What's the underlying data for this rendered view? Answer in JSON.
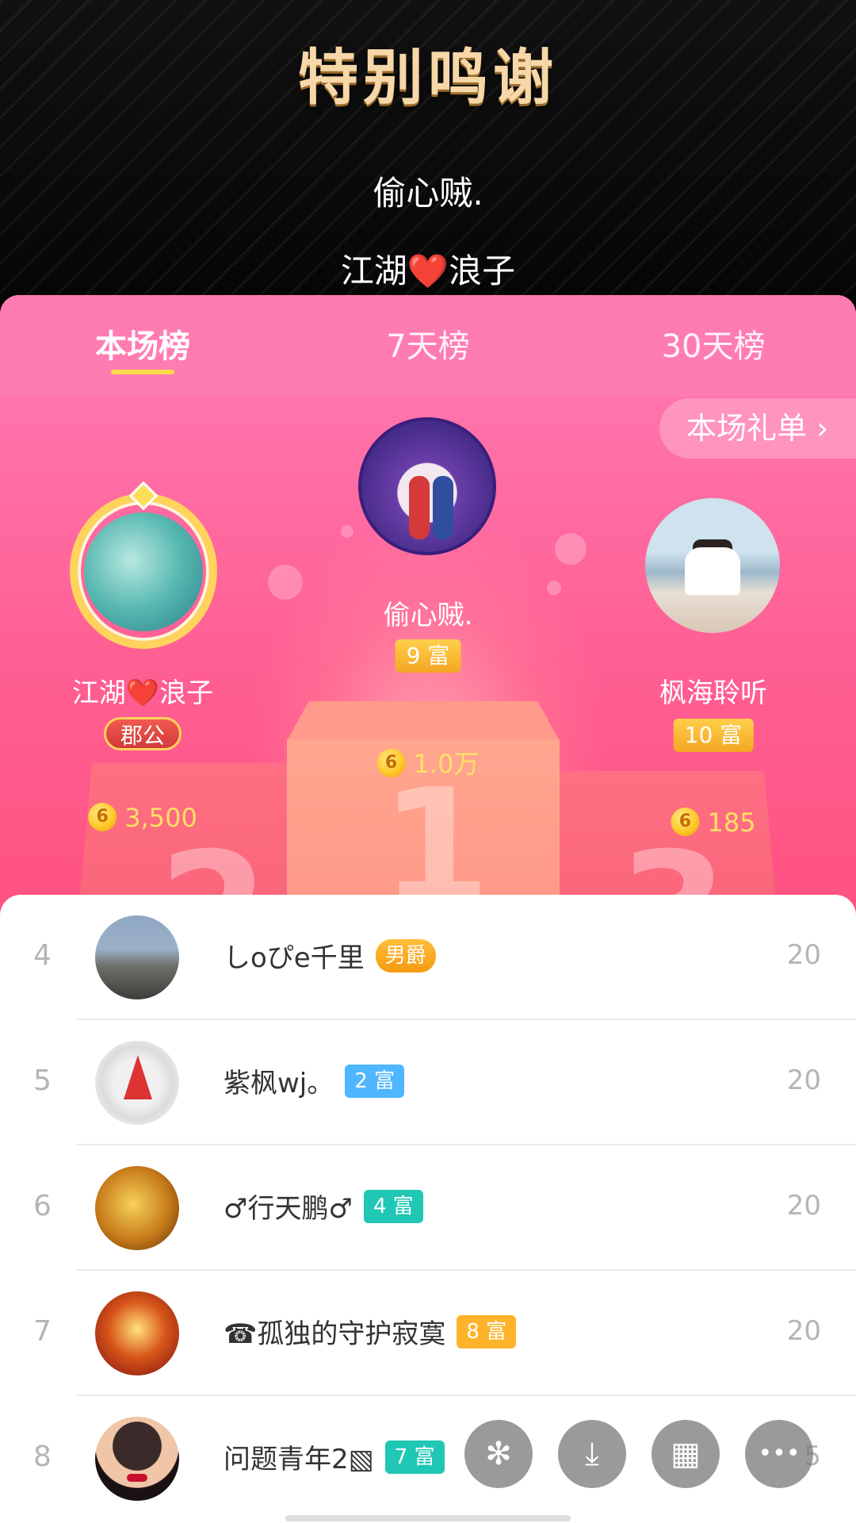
{
  "thanks": {
    "title": "特别鸣谢",
    "names": [
      "偷心贼.",
      "江湖❤️浪子"
    ]
  },
  "tabs": [
    {
      "label": "本场榜",
      "active": true
    },
    {
      "label": "7天榜",
      "active": false
    },
    {
      "label": "30天榜",
      "active": false
    }
  ],
  "gift_list_button": "本场礼单 ›",
  "podium": {
    "first": {
      "rank": "1",
      "name": "偷心贼.",
      "badge": "9 富",
      "score": "1.0万"
    },
    "second": {
      "rank": "2",
      "name": "江湖❤️浪子",
      "badge": "郡公",
      "score": "3,500"
    },
    "third": {
      "rank": "3",
      "name": "枫海聆听",
      "badge": "10 富",
      "score": "185"
    }
  },
  "coin_symbol": "6",
  "list": [
    {
      "rank": "4",
      "name": "しoぴe千里",
      "badge": "男爵",
      "badge_style": "title",
      "score": "20"
    },
    {
      "rank": "5",
      "name": "紫枫wj。",
      "badge": "2 富",
      "badge_style": "blue",
      "score": "20"
    },
    {
      "rank": "6",
      "name": "♂行天鹏♂",
      "badge": "4 富",
      "badge_style": "teal",
      "score": "20"
    },
    {
      "rank": "7",
      "name": "☎孤独的守护寂寞",
      "badge": "8 富",
      "badge_style": "orange",
      "score": "20"
    },
    {
      "rank": "8",
      "name": "问题青年2▧",
      "badge": "7 富",
      "badge_style": "teal",
      "score": "5"
    }
  ],
  "fabs": [
    {
      "icon": "asterisk-icon",
      "glyph": "✻"
    },
    {
      "icon": "download-icon",
      "glyph": "⤓"
    },
    {
      "icon": "grid-icon",
      "glyph": "▦"
    },
    {
      "icon": "more-icon",
      "glyph": "•••"
    }
  ],
  "colors": {
    "accent_pink": "#ff5f93",
    "tab_underline": "#ffd84a",
    "score_yellow": "#ffe066"
  }
}
